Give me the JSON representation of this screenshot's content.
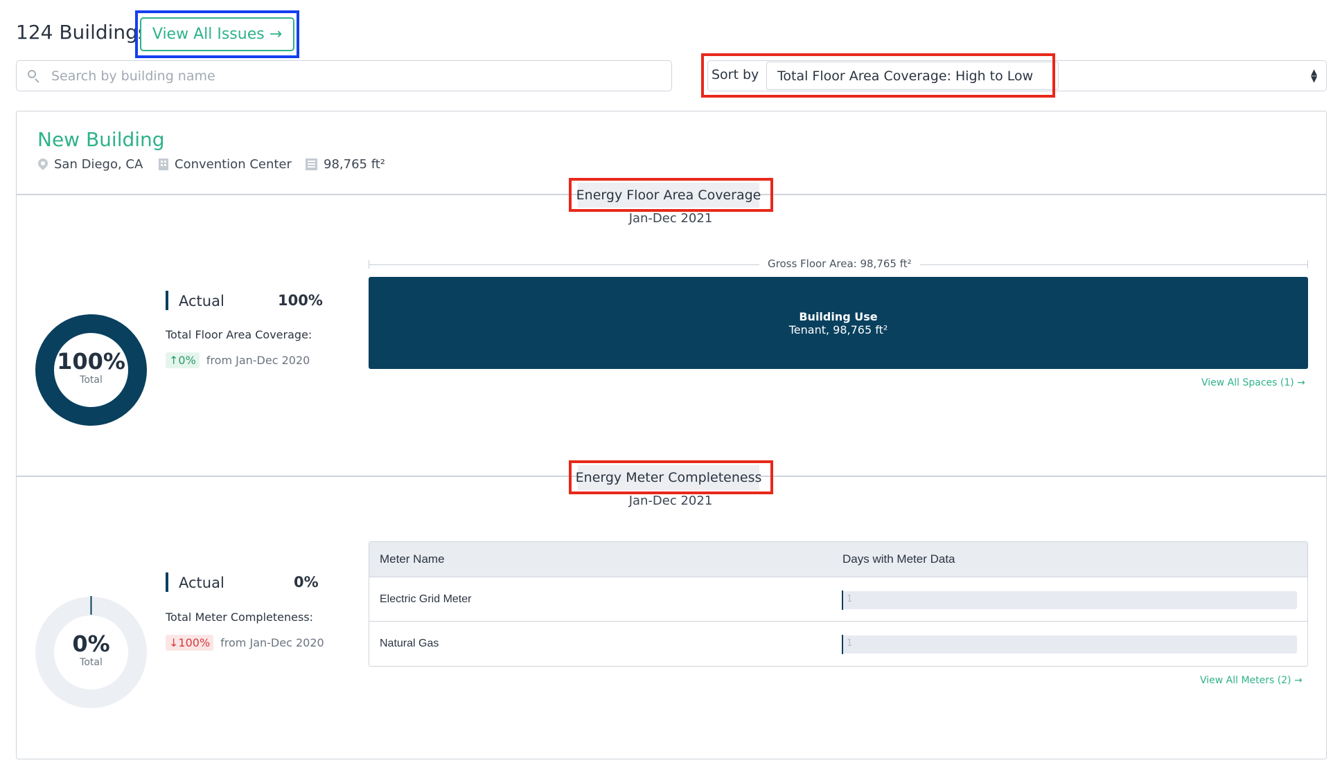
{
  "header": {
    "building_count": "124 Buildings",
    "view_issues_label": "View All Issues →",
    "search_placeholder": "Search by building name",
    "sort_label": "Sort by",
    "sort_value": "Total Floor Area Coverage: High to Low"
  },
  "building": {
    "name": "New Building",
    "location": "San Diego, CA",
    "type": "Convention Center",
    "area": "98,765 ft²"
  },
  "floor_area": {
    "title": "Energy Floor Area Coverage",
    "period": "Jan-Dec 2021",
    "donut_value": "100%",
    "donut_fraction": 1.0,
    "donut_sub": "Total",
    "actual_label": "Actual",
    "actual_value": "100%",
    "metric_label": "Total Floor Area Coverage:",
    "change": "↑0%",
    "change_from": "from Jan-Dec 2020",
    "gross_label": "Gross Floor Area: 98,765 ft²",
    "use_title": "Building Use",
    "use_detail": "Tenant, 98,765 ft²",
    "link": "View All Spaces (1) →"
  },
  "meters": {
    "title": "Energy Meter Completeness",
    "period": "Jan-Dec 2021",
    "donut_value": "0%",
    "donut_fraction": 0.0,
    "donut_sub": "Total",
    "actual_label": "Actual",
    "actual_value": "0%",
    "metric_label": "Total Meter Completeness:",
    "change": "↓100%",
    "change_from": "from Jan-Dec 2020",
    "col_name": "Meter Name",
    "col_days": "Days with Meter Data",
    "rows": [
      {
        "name": "Electric Grid Meter",
        "days": "1"
      },
      {
        "name": "Natural Gas",
        "days": "1"
      }
    ],
    "link": "View All Meters (2) →"
  },
  "colors": {
    "accent": "#2eb28b",
    "navy": "#09405e",
    "highlight_red": "#e8281b",
    "highlight_blue": "#1440f0"
  }
}
